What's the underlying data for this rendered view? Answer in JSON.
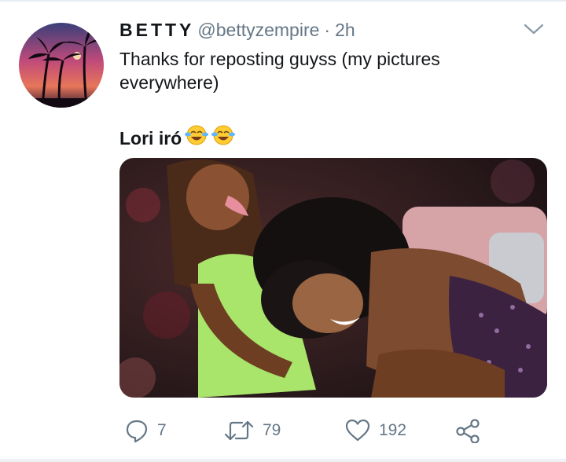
{
  "tweet": {
    "display_name": "BETTY",
    "handle": "@bettyzempire",
    "separator": "·",
    "time": "2h",
    "text_line1": "Thanks for reposting guyss (my pictures",
    "text_line2": "everywhere)",
    "text_line3": "Lori iró",
    "emoji_names": [
      "face-with-tears-of-joy-icon",
      "face-with-tears-of-joy-icon"
    ]
  },
  "actions": {
    "reply_count": "7",
    "retweet_count": "79",
    "like_count": "192"
  },
  "colors": {
    "text": "#14171a",
    "secondary": "#657786",
    "divider": "#e6ecf0"
  }
}
